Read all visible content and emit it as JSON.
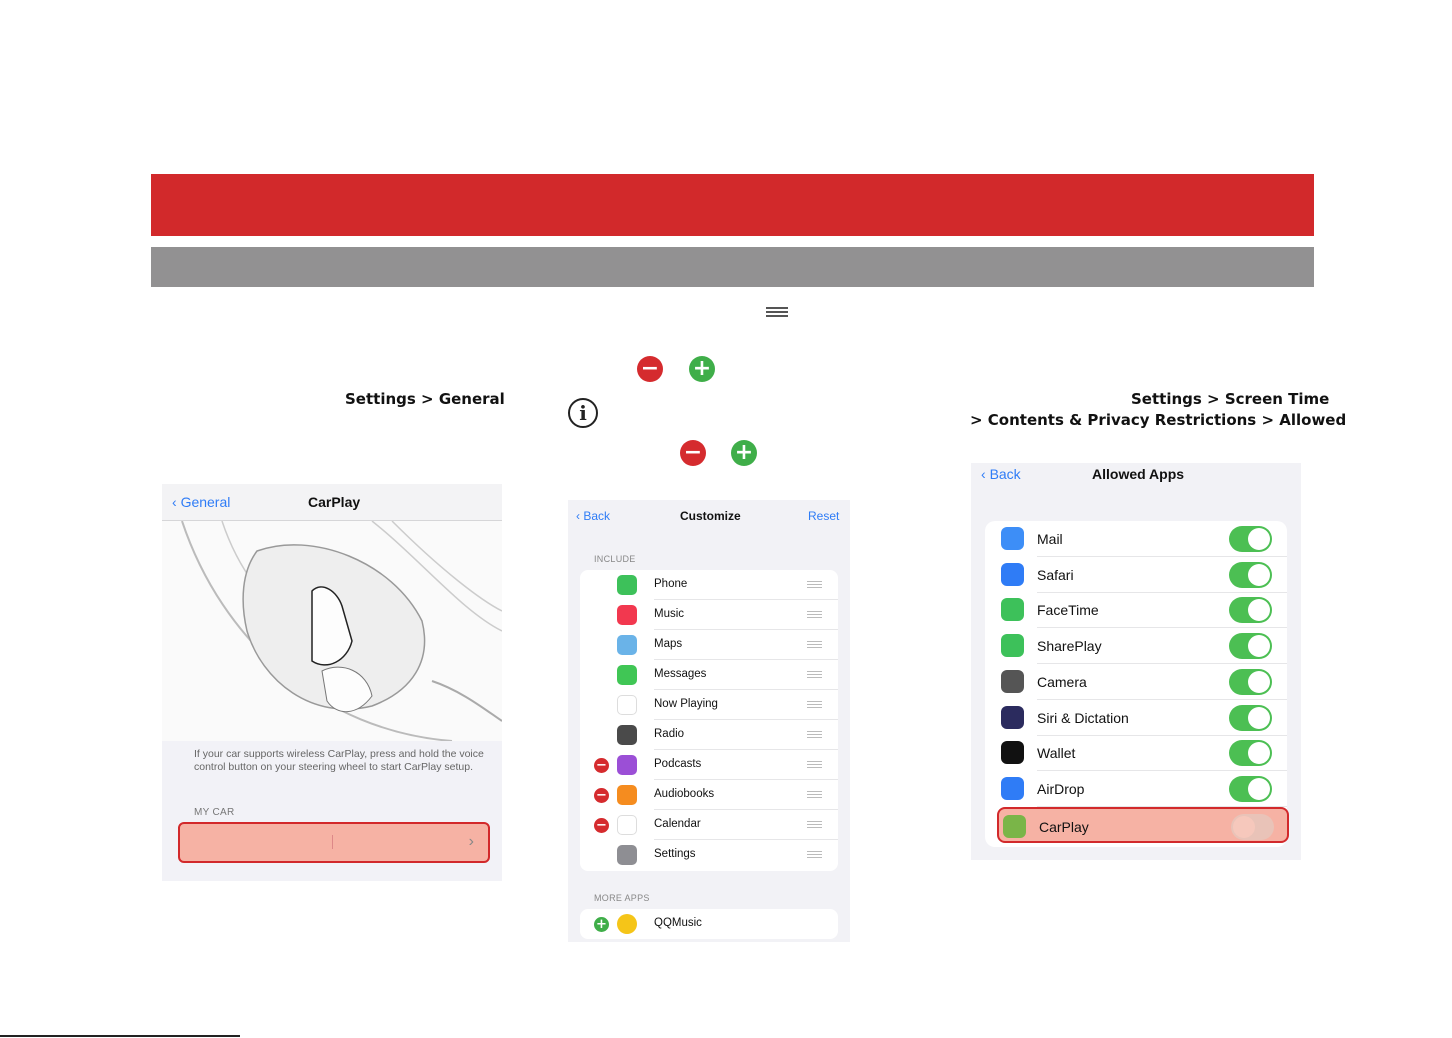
{
  "step1": {
    "path": "Settings > General"
  },
  "step2": {
    "minus_icon": "−",
    "plus_icon": "+",
    "info_icon": "i"
  },
  "step3": {
    "path_line1": "Settings > Screen Time",
    "path_line2": "> Contents & Privacy Restrictions > Allowed"
  },
  "screen1": {
    "back_label": "General",
    "title": "CarPlay",
    "description": "If your car supports wireless CarPlay, press and hold the voice control button on your steering wheel to start CarPlay setup.",
    "section_label": "MY CAR",
    "chevron": "›"
  },
  "screen2": {
    "back_label": "Back",
    "title": "Customize",
    "reset_label": "Reset",
    "include_label": "INCLUDE",
    "more_label": "MORE APPS",
    "include_items": [
      {
        "label": "Phone",
        "color": "#3dc15a",
        "removable": false
      },
      {
        "label": "Music",
        "color": "#f2384f",
        "removable": false
      },
      {
        "label": "Maps",
        "color": "#6ab3e8",
        "removable": false
      },
      {
        "label": "Messages",
        "color": "#40c655",
        "removable": false
      },
      {
        "label": "Now Playing",
        "color": "#ffffff",
        "removable": false
      },
      {
        "label": "Radio",
        "color": "#4a4a4a",
        "removable": false
      },
      {
        "label": "Podcasts",
        "color": "#9b4fd6",
        "removable": true
      },
      {
        "label": "Audiobooks",
        "color": "#f58c1f",
        "removable": true
      },
      {
        "label": "Calendar",
        "color": "#ffffff",
        "removable": true
      },
      {
        "label": "Settings",
        "color": "#8e8e93",
        "removable": false
      }
    ],
    "more_items": [
      {
        "label": "QQMusic",
        "color": "#f5c518"
      }
    ]
  },
  "screen3": {
    "back_label": "Back",
    "title": "Allowed Apps",
    "apps": [
      {
        "label": "Mail",
        "color": "#3d8ef7",
        "on": true
      },
      {
        "label": "Safari",
        "color": "#2f7cf6",
        "on": true
      },
      {
        "label": "FaceTime",
        "color": "#3dc15a",
        "on": true
      },
      {
        "label": "SharePlay",
        "color": "#3dc15a",
        "on": true
      },
      {
        "label": "Camera",
        "color": "#555555",
        "on": true
      },
      {
        "label": "Siri & Dictation",
        "color": "#2b2b5e",
        "on": true
      },
      {
        "label": "Wallet",
        "color": "#111111",
        "on": true
      },
      {
        "label": "AirDrop",
        "color": "#2f7cf6",
        "on": true
      },
      {
        "label": "CarPlay",
        "color": "#7ab548",
        "on": false
      }
    ]
  }
}
